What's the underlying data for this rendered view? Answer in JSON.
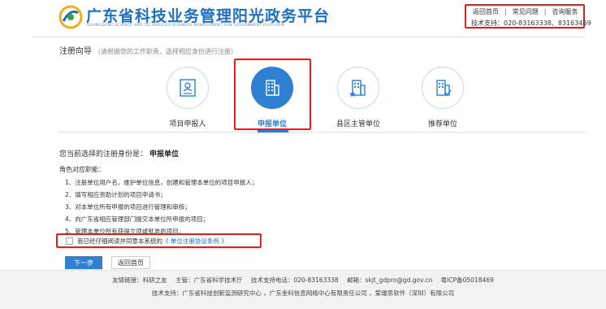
{
  "header": {
    "title": "广东省科技业务管理阳光政务平台",
    "subtitle": "GUANGDONG SCIENCE AND TECHNOLOGY BUSINESS MANAGEMENT SUN GOVERNMENT PLATFORM",
    "links": [
      "返回首页",
      "常见问题",
      "咨询服务"
    ],
    "support": "技术支持：020-83163338、83163469"
  },
  "wizard": {
    "title": "注册向导",
    "hint": "（请根据您的工作职责，选择相应身份进行注册）",
    "roles": [
      {
        "label": "项目申报人",
        "icon": "id-card-icon",
        "active": false
      },
      {
        "label": "申报单位",
        "icon": "building-icon",
        "active": true
      },
      {
        "label": "县区主管单位",
        "icon": "building-star-icon",
        "active": false
      },
      {
        "label": "推荐单位",
        "icon": "building-check-icon",
        "active": false
      }
    ]
  },
  "content": {
    "current_prefix": "您当前选择的注册身份是：",
    "current_role": "申报单位",
    "duties_title": "角色对应职能：",
    "duties": [
      "1、注册单位用户名，维护单位信息，创建和管理本单位的项目申报人；",
      "2、填写相应资助计划的项目申请书；",
      "3、对本单位所有申报的项目进行管理和审核；",
      "4、向广东省相应管理部门提交本单位所申报的项目；",
      "5、管理本单位所有获得立项或批准的项目。"
    ],
    "agree_text": "我已经仔细阅读并同意本系统的",
    "agree_link": "《 单位注册协议条例 》",
    "next_button": "下一步",
    "back_button": "返回首页"
  },
  "footer": {
    "friend_links": "友情链接：",
    "friend_value": "科研之友",
    "host": "主管：广东省科学技术厅",
    "support_phone": "技术支持电话：020-83163338",
    "email": "邮箱：skjt_gdpro@gd.gov.cn",
    "icp": "粤ICP备05018469",
    "tech_support": "技术支持：广东省科技创新监测研究中心 ，广东金科信息网络中心有限责任公司 ，爱瑞思软件（深圳）有限公司"
  },
  "colors": {
    "brand_blue": "#1d6fbf",
    "active_blue": "#2f80d0",
    "highlight_red": "#e02020"
  }
}
